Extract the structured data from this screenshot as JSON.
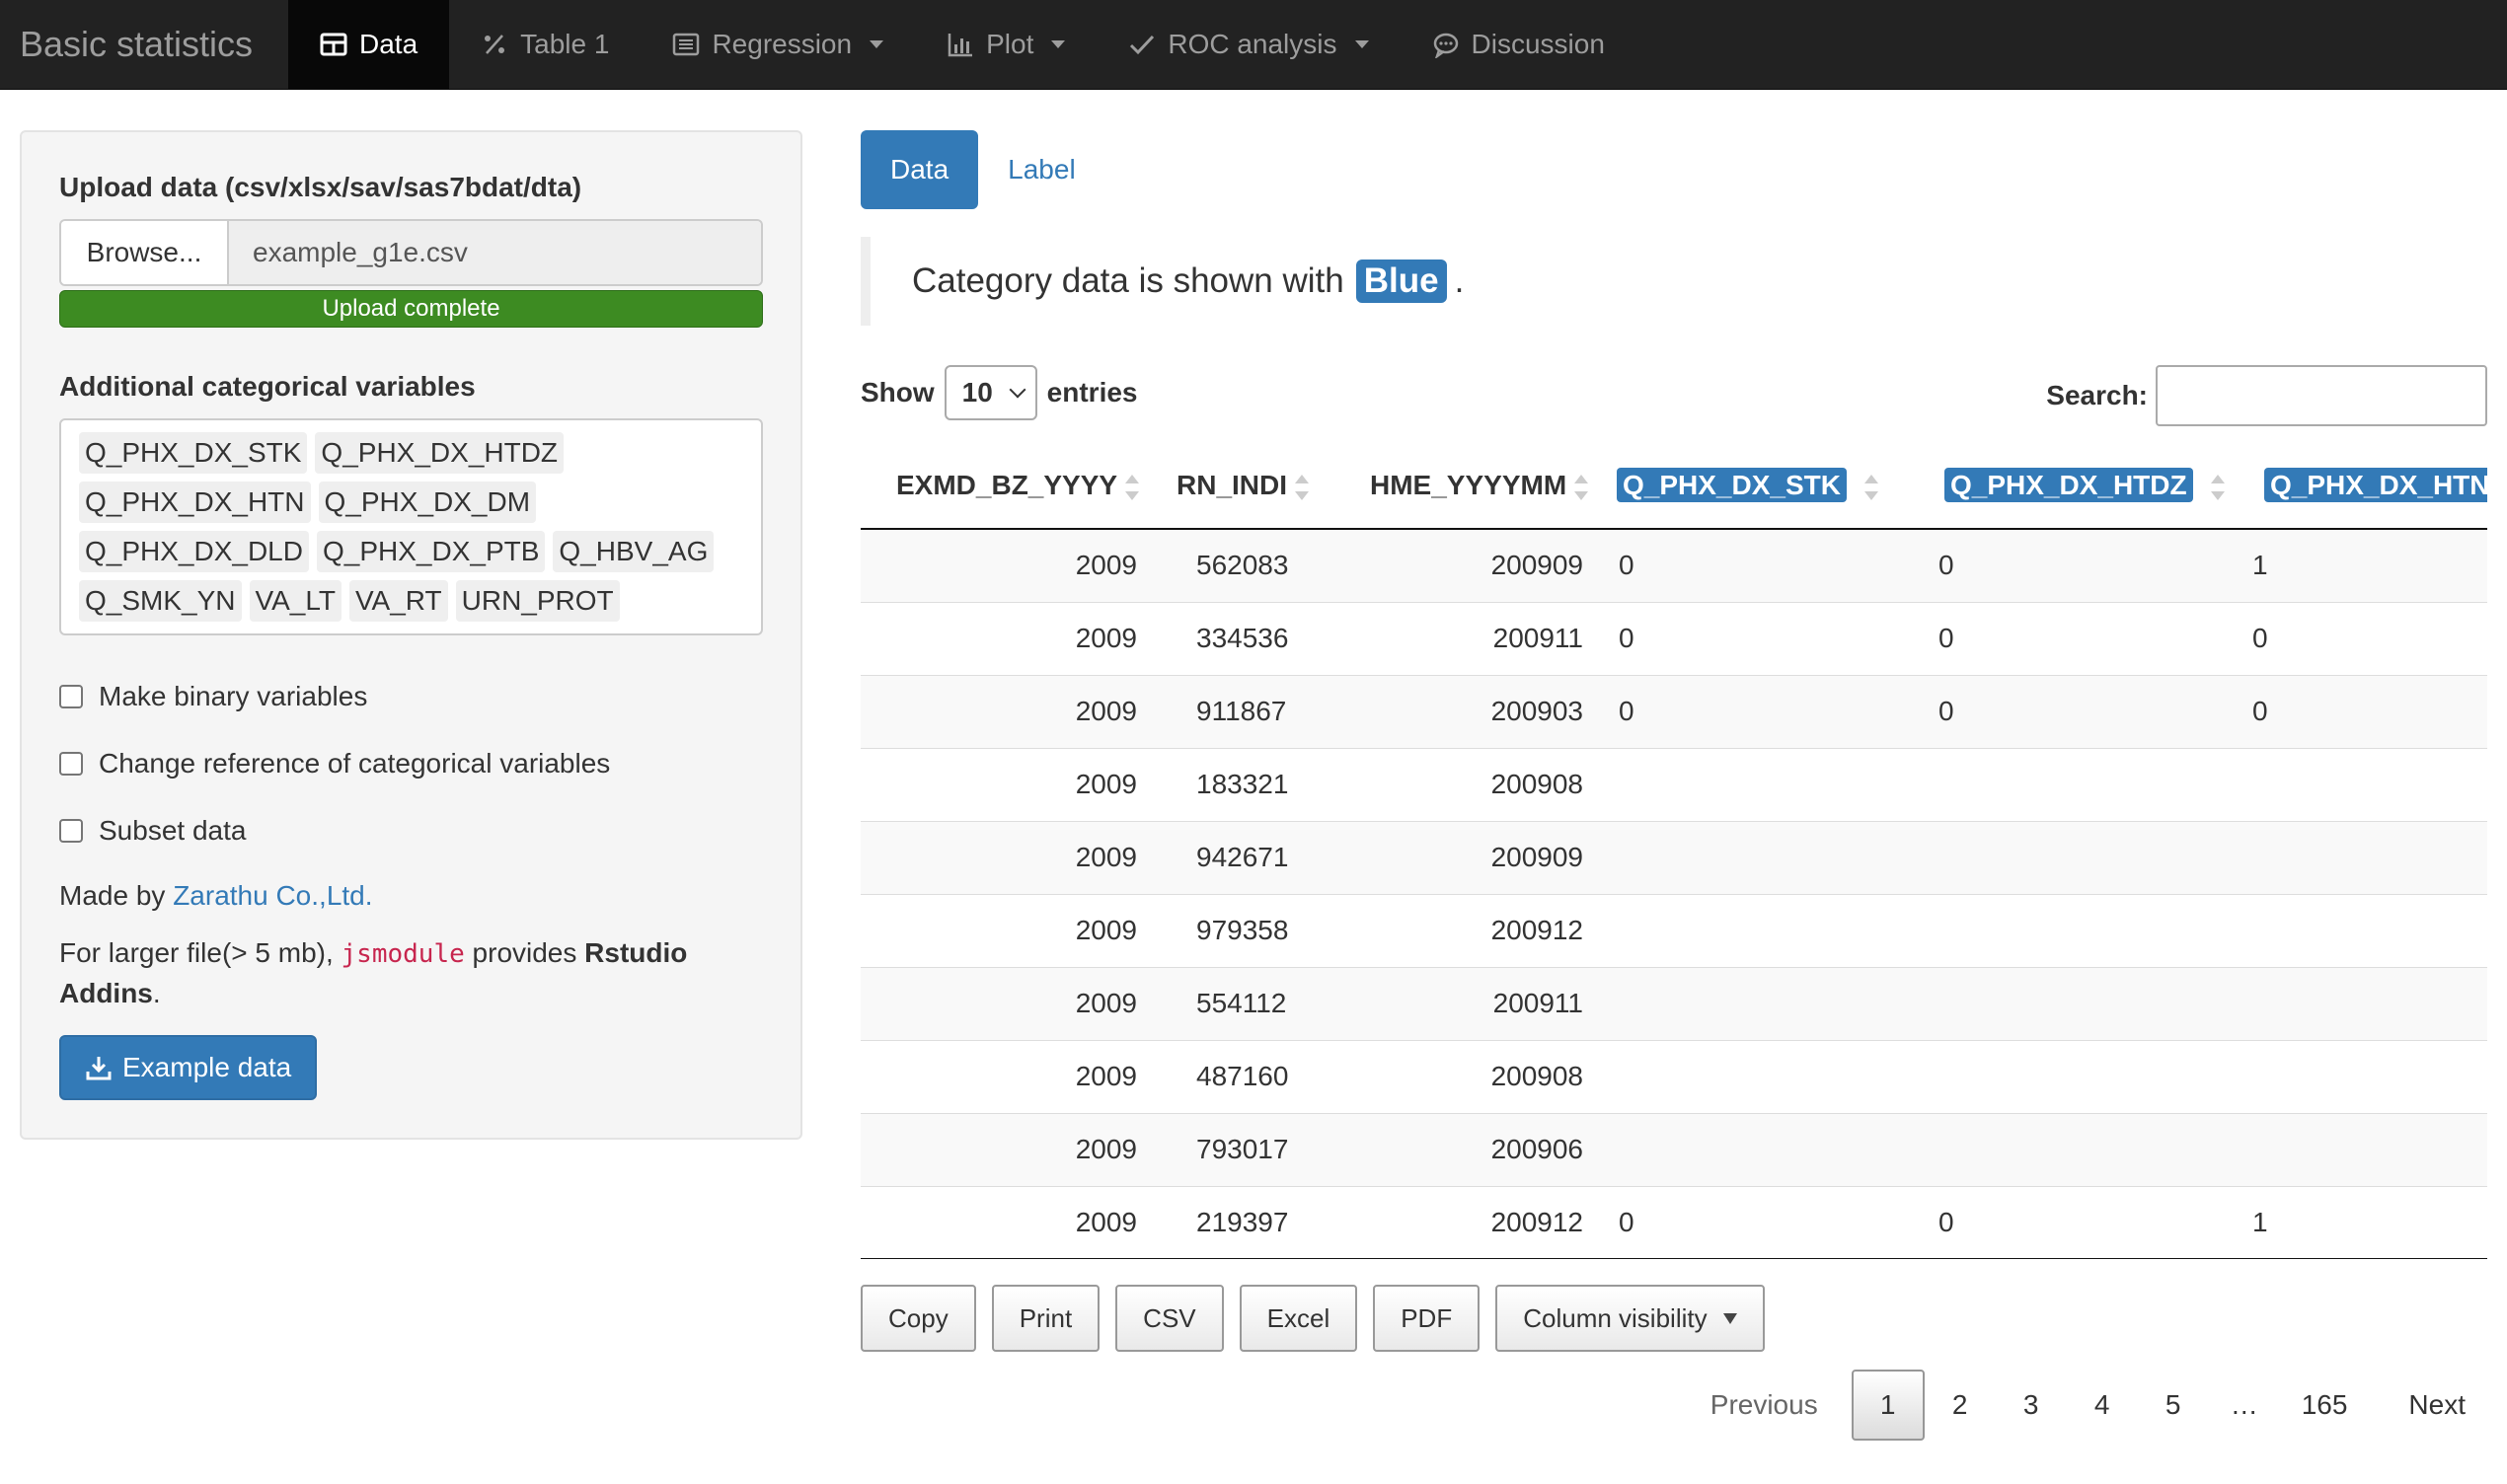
{
  "navbar": {
    "brand": "Basic statistics",
    "items": [
      {
        "label": "Data",
        "icon": "table-icon",
        "active": true,
        "dropdown": false
      },
      {
        "label": "Table 1",
        "icon": "percent-icon",
        "active": false,
        "dropdown": false
      },
      {
        "label": "Regression",
        "icon": "list-icon",
        "active": false,
        "dropdown": true
      },
      {
        "label": "Plot",
        "icon": "bar-chart-icon",
        "active": false,
        "dropdown": true
      },
      {
        "label": "ROC analysis",
        "icon": "check-icon",
        "active": false,
        "dropdown": true
      },
      {
        "label": "Discussion",
        "icon": "chat-bubble-icon",
        "active": false,
        "dropdown": false
      }
    ]
  },
  "sidebar": {
    "upload_label": "Upload data (csv/xlsx/sav/sas7bdat/dta)",
    "browse_label": "Browse...",
    "file_name": "example_g1e.csv",
    "progress_text": "Upload complete",
    "progress": 1.0,
    "categorical_label": "Additional categorical variables",
    "categorical_tags": [
      "Q_PHX_DX_STK",
      "Q_PHX_DX_HTDZ",
      "Q_PHX_DX_HTN",
      "Q_PHX_DX_DM",
      "Q_PHX_DX_DLD",
      "Q_PHX_DX_PTB",
      "Q_HBV_AG",
      "Q_SMK_YN",
      "VA_LT",
      "VA_RT",
      "URN_PROT"
    ],
    "checkboxes": [
      {
        "label": "Make binary variables",
        "checked": false
      },
      {
        "label": "Change reference of categorical variables",
        "checked": false
      },
      {
        "label": "Subset data",
        "checked": false
      }
    ],
    "made_by_prefix": "Made by",
    "made_by_link": "Zarathu Co.,Ltd.",
    "larger_prefix": "For larger file(> 5 mb),",
    "larger_code": "jsmodule",
    "larger_mid": "provides",
    "larger_strong": "Rstudio Addins",
    "larger_suffix": ".",
    "example_button": "Example data"
  },
  "main": {
    "tabs": [
      {
        "label": "Data",
        "active": true
      },
      {
        "label": "Label",
        "active": false
      }
    ],
    "callout_prefix": "Category data is shown with",
    "callout_highlight": "Blue",
    "callout_suffix": ".",
    "show_label": "Show",
    "entries_value": "10",
    "entries_label": "entries",
    "search_label": "Search:",
    "search_value": ""
  },
  "table": {
    "columns": [
      {
        "label": "EXMD_BZ_YYYY",
        "categorical": false
      },
      {
        "label": "RN_INDI",
        "categorical": false
      },
      {
        "label": "HME_YYYYMM",
        "categorical": false
      },
      {
        "label": "Q_PHX_DX_STK",
        "categorical": true
      },
      {
        "label": "Q_PHX_DX_HTDZ",
        "categorical": true
      },
      {
        "label": "Q_PHX_DX_HTN",
        "categorical": true
      }
    ],
    "rows": [
      [
        "2009",
        "562083",
        "200909",
        "0",
        "0",
        "1"
      ],
      [
        "2009",
        "334536",
        "200911",
        "0",
        "0",
        "0"
      ],
      [
        "2009",
        "911867",
        "200903",
        "0",
        "0",
        "0"
      ],
      [
        "2009",
        "183321",
        "200908",
        "",
        "",
        ""
      ],
      [
        "2009",
        "942671",
        "200909",
        "",
        "",
        ""
      ],
      [
        "2009",
        "979358",
        "200912",
        "",
        "",
        ""
      ],
      [
        "2009",
        "554112",
        "200911",
        "",
        "",
        ""
      ],
      [
        "2009",
        "487160",
        "200908",
        "",
        "",
        ""
      ],
      [
        "2009",
        "793017",
        "200906",
        "",
        "",
        ""
      ],
      [
        "2009",
        "219397",
        "200912",
        "0",
        "0",
        "1"
      ]
    ]
  },
  "export_buttons": [
    "Copy",
    "Print",
    "CSV",
    "Excel",
    "PDF"
  ],
  "column_visibility": "Column visibility",
  "pagination": {
    "previous": "Previous",
    "pages": [
      "1",
      "2",
      "3",
      "4",
      "5",
      "…",
      "165"
    ],
    "current": "1",
    "next": "Next"
  },
  "colors": {
    "navbar_bg": "#222222",
    "accent_blue": "#337ab7",
    "progress_green": "#3d8b22"
  }
}
